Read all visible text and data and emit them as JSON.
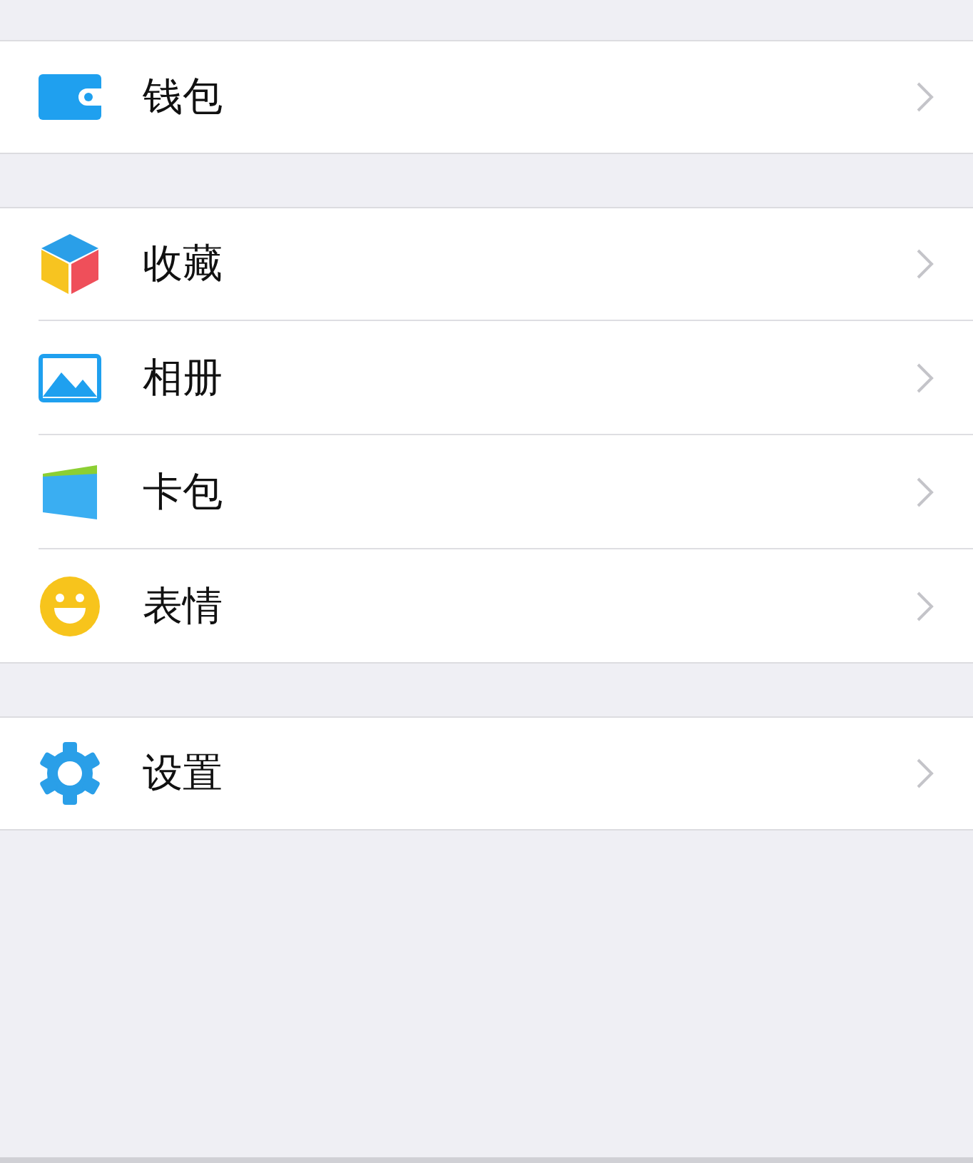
{
  "groups": [
    {
      "items": [
        {
          "kind": "wallet",
          "label": "钱包"
        }
      ]
    },
    {
      "items": [
        {
          "kind": "cube",
          "label": "收藏"
        },
        {
          "kind": "photo",
          "label": "相册"
        },
        {
          "kind": "card",
          "label": "卡包"
        },
        {
          "kind": "smile",
          "label": "表情"
        }
      ]
    },
    {
      "items": [
        {
          "kind": "gear",
          "label": "设置"
        }
      ]
    }
  ]
}
